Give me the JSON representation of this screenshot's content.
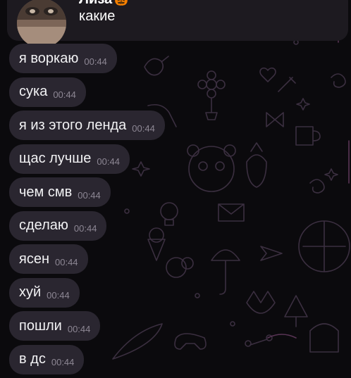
{
  "reply": {
    "name": "Лиза",
    "emoji": "🎃",
    "text": "какие"
  },
  "messages": [
    {
      "text": "я воркаю",
      "time": "00:44"
    },
    {
      "text": "сука",
      "time": "00:44"
    },
    {
      "text": "я из этого ленда",
      "time": "00:44"
    },
    {
      "text": "щас лучше",
      "time": "00:44"
    },
    {
      "text": "чем смв",
      "time": "00:44"
    },
    {
      "text": "сделаю",
      "time": "00:44"
    },
    {
      "text": "ясен",
      "time": "00:44"
    },
    {
      "text": "хуй",
      "time": "00:44"
    },
    {
      "text": "пошли",
      "time": "00:44"
    },
    {
      "text": "в дс",
      "time": "00:44"
    }
  ],
  "colors": {
    "background": "#0b0a0d",
    "bubble": "#2a2630",
    "doodle": "#3a2e3f",
    "doodle_accent": "#5a3a58"
  }
}
